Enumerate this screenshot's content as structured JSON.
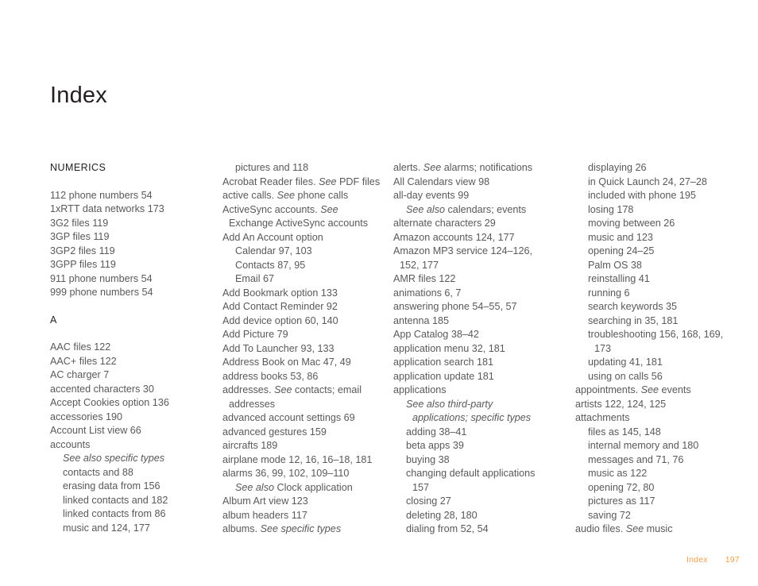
{
  "title": "Index",
  "footer": {
    "label": "Index",
    "page_number": "197"
  },
  "colors": {
    "title": "#231f20",
    "body": "#58595b",
    "footer": "#f5a04a",
    "background": "#ffffff"
  },
  "columns": [
    {
      "id": "column-1",
      "blocks": [
        {
          "type": "heading",
          "text": "NUMERICS"
        },
        {
          "type": "entry",
          "level": 1,
          "text": "112 phone numbers 54"
        },
        {
          "type": "entry",
          "level": 1,
          "text": "1xRTT data networks 173"
        },
        {
          "type": "entry",
          "level": 1,
          "text": "3G2 files 119"
        },
        {
          "type": "entry",
          "level": 1,
          "text": "3GP files 119"
        },
        {
          "type": "entry",
          "level": 1,
          "text": "3GP2 files 119"
        },
        {
          "type": "entry",
          "level": 1,
          "text": "3GPP files 119"
        },
        {
          "type": "entry",
          "level": 1,
          "text": "911 phone numbers 54"
        },
        {
          "type": "entry",
          "level": 1,
          "text": "999 phone numbers 54"
        },
        {
          "type": "heading",
          "text": "A"
        },
        {
          "type": "entry",
          "level": 1,
          "text": "AAC files 122"
        },
        {
          "type": "entry",
          "level": 1,
          "text": "AAC+ files 122"
        },
        {
          "type": "entry",
          "level": 1,
          "text": "AC charger 7"
        },
        {
          "type": "entry",
          "level": 1,
          "text": "accented characters 30"
        },
        {
          "type": "entry",
          "level": 1,
          "text": "Accept Cookies option 136"
        },
        {
          "type": "entry",
          "level": 1,
          "text": "accessories 190"
        },
        {
          "type": "entry",
          "level": 1,
          "text": "Account List view 66"
        },
        {
          "type": "entry",
          "level": 1,
          "text": "accounts"
        },
        {
          "type": "entry",
          "level": 2,
          "italic": true,
          "text": "See also specific types"
        },
        {
          "type": "entry",
          "level": 2,
          "text": "contacts and 88"
        },
        {
          "type": "entry",
          "level": 2,
          "text": "erasing data from 156"
        },
        {
          "type": "entry",
          "level": 2,
          "text": "linked contacts and 182"
        },
        {
          "type": "entry",
          "level": 2,
          "text": "linked contacts from 86"
        },
        {
          "type": "entry",
          "level": 2,
          "text": "music and 124, 177"
        }
      ]
    },
    {
      "id": "column-2",
      "blocks": [
        {
          "type": "entry",
          "level": 2,
          "text": "pictures and 118"
        },
        {
          "type": "entry",
          "level": 1,
          "text": "Acrobat Reader files. See PDF files",
          "italic_part": "See"
        },
        {
          "type": "entry",
          "level": 1,
          "text": "active calls. See phone calls",
          "italic_part": "See"
        },
        {
          "type": "entry",
          "level": 1,
          "text": "ActiveSync accounts. See",
          "italic_part": "See"
        },
        {
          "type": "entry",
          "level": 1,
          "continuation": true,
          "text": "Exchange ActiveSync accounts"
        },
        {
          "type": "entry",
          "level": 1,
          "text": "Add An Account option"
        },
        {
          "type": "entry",
          "level": 2,
          "text": "Calendar 97, 103"
        },
        {
          "type": "entry",
          "level": 2,
          "text": "Contacts 87, 95"
        },
        {
          "type": "entry",
          "level": 2,
          "text": "Email 67"
        },
        {
          "type": "entry",
          "level": 1,
          "text": "Add Bookmark option 133"
        },
        {
          "type": "entry",
          "level": 1,
          "text": "Add Contact Reminder 92"
        },
        {
          "type": "entry",
          "level": 1,
          "text": "Add device option 60, 140"
        },
        {
          "type": "entry",
          "level": 1,
          "text": "Add Picture 79"
        },
        {
          "type": "entry",
          "level": 1,
          "text": "Add To Launcher 93, 133"
        },
        {
          "type": "entry",
          "level": 1,
          "text": "Address Book on Mac 47, 49"
        },
        {
          "type": "entry",
          "level": 1,
          "text": "address books 53, 86"
        },
        {
          "type": "entry",
          "level": 1,
          "text": "addresses. See contacts; email",
          "italic_part": "See"
        },
        {
          "type": "entry",
          "level": 1,
          "continuation": true,
          "text": "addresses"
        },
        {
          "type": "entry",
          "level": 1,
          "text": "advanced account settings 69"
        },
        {
          "type": "entry",
          "level": 1,
          "text": "advanced gestures 159"
        },
        {
          "type": "entry",
          "level": 1,
          "text": "aircrafts 189"
        },
        {
          "type": "entry",
          "level": 1,
          "text": "airplane mode 12, 16, 16–18, 181"
        },
        {
          "type": "entry",
          "level": 1,
          "text": "alarms 36, 99, 102, 109–110"
        },
        {
          "type": "entry",
          "level": 2,
          "text": "See also Clock application",
          "italic_part": "See also"
        },
        {
          "type": "entry",
          "level": 1,
          "text": "Album Art view 123"
        },
        {
          "type": "entry",
          "level": 1,
          "text": "album headers 117"
        },
        {
          "type": "entry",
          "level": 1,
          "text": "albums. See specific types",
          "italic_part": "See specific types"
        }
      ]
    },
    {
      "id": "column-3",
      "blocks": [
        {
          "type": "entry",
          "level": 1,
          "text": "alerts. See alarms; notifications",
          "italic_part": "See"
        },
        {
          "type": "entry",
          "level": 1,
          "text": "All Calendars view 98"
        },
        {
          "type": "entry",
          "level": 1,
          "text": "all-day events 99"
        },
        {
          "type": "entry",
          "level": 2,
          "text": "See also calendars; events",
          "italic_part": "See also"
        },
        {
          "type": "entry",
          "level": 1,
          "text": "alternate characters 29"
        },
        {
          "type": "entry",
          "level": 1,
          "text": "Amazon accounts 124, 177"
        },
        {
          "type": "entry",
          "level": 1,
          "text": "Amazon MP3 service 124–126,"
        },
        {
          "type": "entry",
          "level": 1,
          "continuation": true,
          "text": "152, 177"
        },
        {
          "type": "entry",
          "level": 1,
          "text": "AMR files 122"
        },
        {
          "type": "entry",
          "level": 1,
          "text": "animations 6, 7"
        },
        {
          "type": "entry",
          "level": 1,
          "text": "answering phone 54–55, 57"
        },
        {
          "type": "entry",
          "level": 1,
          "text": "antenna 185"
        },
        {
          "type": "entry",
          "level": 1,
          "text": "App Catalog 38–42"
        },
        {
          "type": "entry",
          "level": 1,
          "text": "application menu 32, 181"
        },
        {
          "type": "entry",
          "level": 1,
          "text": "application search 181"
        },
        {
          "type": "entry",
          "level": 1,
          "text": "application update 181"
        },
        {
          "type": "entry",
          "level": 1,
          "text": "applications"
        },
        {
          "type": "entry",
          "level": 2,
          "italic": true,
          "text": "See also third-party"
        },
        {
          "type": "entry",
          "level": 2,
          "continuation": true,
          "italic": true,
          "text": "applications; specific types"
        },
        {
          "type": "entry",
          "level": 2,
          "text": "adding 38–41"
        },
        {
          "type": "entry",
          "level": 2,
          "text": "beta apps 39"
        },
        {
          "type": "entry",
          "level": 2,
          "text": "buying 38"
        },
        {
          "type": "entry",
          "level": 2,
          "text": "changing default applications"
        },
        {
          "type": "entry",
          "level": 2,
          "continuation": true,
          "text": "157"
        },
        {
          "type": "entry",
          "level": 2,
          "text": "closing 27"
        },
        {
          "type": "entry",
          "level": 2,
          "text": "deleting 28, 180"
        },
        {
          "type": "entry",
          "level": 2,
          "text": "dialing from 52, 54"
        }
      ]
    },
    {
      "id": "column-4",
      "blocks": [
        {
          "type": "entry",
          "level": 2,
          "text": "displaying 26"
        },
        {
          "type": "entry",
          "level": 2,
          "text": "in Quick Launch 24, 27–28"
        },
        {
          "type": "entry",
          "level": 2,
          "text": "included with phone 195"
        },
        {
          "type": "entry",
          "level": 2,
          "text": "losing 178"
        },
        {
          "type": "entry",
          "level": 2,
          "text": "moving between 26"
        },
        {
          "type": "entry",
          "level": 2,
          "text": "music and 123"
        },
        {
          "type": "entry",
          "level": 2,
          "text": "opening 24–25"
        },
        {
          "type": "entry",
          "level": 2,
          "text": "Palm OS 38"
        },
        {
          "type": "entry",
          "level": 2,
          "text": "reinstalling 41"
        },
        {
          "type": "entry",
          "level": 2,
          "text": "running 6"
        },
        {
          "type": "entry",
          "level": 2,
          "text": "search keywords 35"
        },
        {
          "type": "entry",
          "level": 2,
          "text": "searching in 35, 181"
        },
        {
          "type": "entry",
          "level": 2,
          "text": "troubleshooting 156, 168, 169,"
        },
        {
          "type": "entry",
          "level": 2,
          "continuation": true,
          "text": "173"
        },
        {
          "type": "entry",
          "level": 2,
          "text": "updating 41, 181"
        },
        {
          "type": "entry",
          "level": 2,
          "text": "using on calls 56"
        },
        {
          "type": "entry",
          "level": 1,
          "text": "appointments. See events",
          "italic_part": "See"
        },
        {
          "type": "entry",
          "level": 1,
          "text": "artists 122, 124, 125"
        },
        {
          "type": "entry",
          "level": 1,
          "text": "attachments"
        },
        {
          "type": "entry",
          "level": 2,
          "text": "files as 145, 148"
        },
        {
          "type": "entry",
          "level": 2,
          "text": "internal memory and 180"
        },
        {
          "type": "entry",
          "level": 2,
          "text": "messages and 71, 76"
        },
        {
          "type": "entry",
          "level": 2,
          "text": "music as 122"
        },
        {
          "type": "entry",
          "level": 2,
          "text": "opening 72, 80"
        },
        {
          "type": "entry",
          "level": 2,
          "text": "pictures as 117"
        },
        {
          "type": "entry",
          "level": 2,
          "text": "saving 72"
        },
        {
          "type": "entry",
          "level": 1,
          "text": "audio files. See music",
          "italic_part": "See"
        }
      ]
    }
  ]
}
